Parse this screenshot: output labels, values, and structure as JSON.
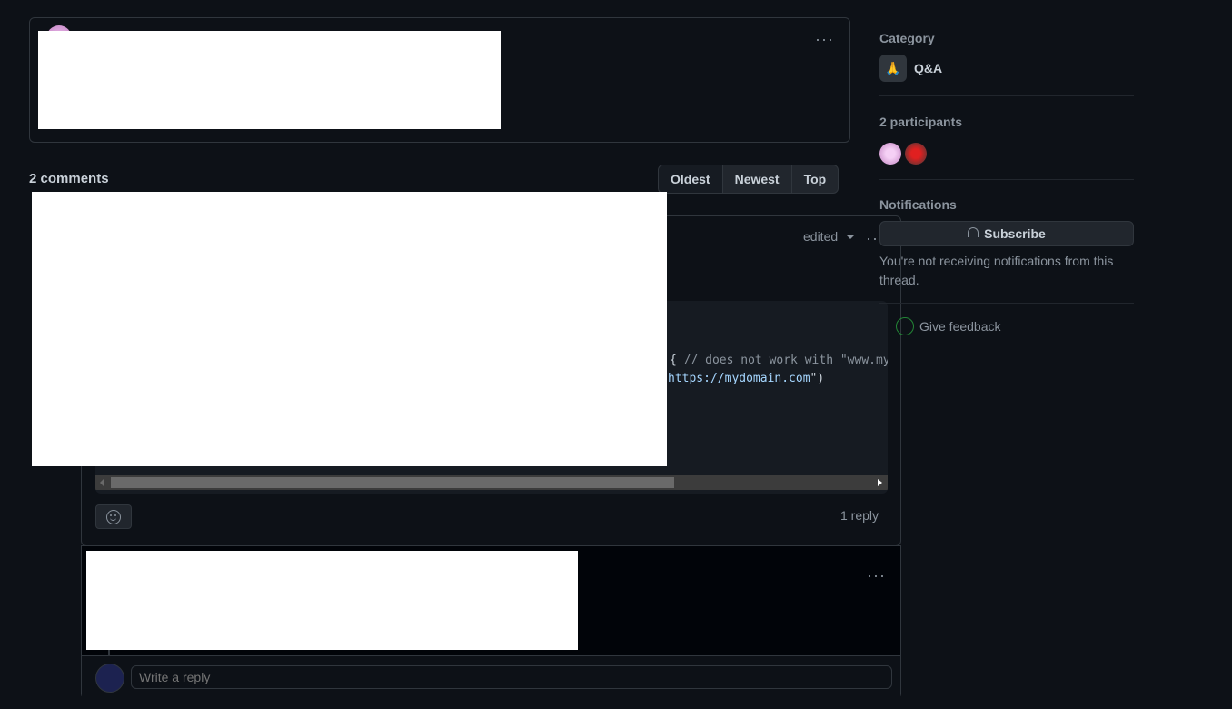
{
  "post": {
    "more_label": "···"
  },
  "comments_header": {
    "count_label": "2 comments",
    "sort_options": [
      "Oldest",
      "Newest",
      "Top"
    ]
  },
  "comment": {
    "edited_label": "edited",
    "code_line_1_brace": "{ ",
    "code_line_1_comment": "// does not work with \"www.my",
    "code_line_2_url": "https://mydomain.com",
    "code_line_2_end": "\")",
    "reply_count": "1 reply"
  },
  "reply_box": {
    "placeholder": "Write a reply"
  },
  "sidebar": {
    "category_label": "Category",
    "category_icon": "🙏",
    "category_name": "Q&A",
    "participants_label": "2 participants",
    "notifications_label": "Notifications",
    "subscribe_label": "Subscribe",
    "notification_text": "You're not receiving notifications from this thread.",
    "feedback_label": "Give feedback"
  },
  "colors": {
    "background": "#0d1117",
    "border": "#30363d",
    "link": "#a5d6ff"
  }
}
